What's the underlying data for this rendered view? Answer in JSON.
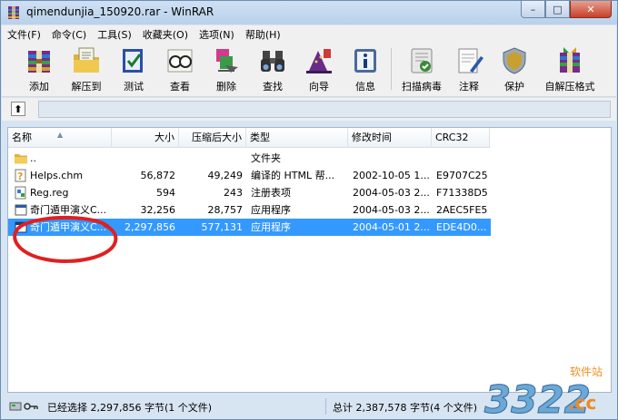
{
  "window": {
    "title": "qimendunjia_150920.rar - WinRAR",
    "controls": {
      "minimize": "–",
      "maximize": "□",
      "close": "✕"
    }
  },
  "menu": [
    "文件(F)",
    "命令(C)",
    "工具(S)",
    "收藏夹(O)",
    "选项(N)",
    "帮助(H)"
  ],
  "toolbar": {
    "add": "添加",
    "extract_to": "解压到",
    "test": "测试",
    "view": "查看",
    "delete": "删除",
    "find": "查找",
    "wizard": "向导",
    "info": "信息",
    "scan_virus": "扫描病毒",
    "comment": "注释",
    "protect": "保护",
    "sfx": "自解压格式"
  },
  "pathbar": {
    "up_icon": "up-arrow-icon"
  },
  "columns": {
    "name": "名称",
    "size": "大小",
    "packed": "压缩后大小",
    "type": "类型",
    "modified": "修改时间",
    "crc": "CRC32"
  },
  "files": [
    {
      "name": "..",
      "size": "",
      "packed": "",
      "type": "文件夹",
      "modified": "",
      "crc": "",
      "icon": "folder-icon"
    },
    {
      "name": "Helps.chm",
      "size": "56,872",
      "packed": "49,249",
      "type": "编译的 HTML 帮...",
      "modified": "2002-10-05 1...",
      "crc": "E9707C25",
      "icon": "chm-help-icon"
    },
    {
      "name": "Reg.reg",
      "size": "594",
      "packed": "243",
      "type": "注册表项",
      "modified": "2004-05-03 2...",
      "crc": "F71338D5",
      "icon": "registry-icon"
    },
    {
      "name": "奇门遁甲演义C...",
      "size": "32,256",
      "packed": "28,757",
      "type": "应用程序",
      "modified": "2004-05-03 2...",
      "crc": "2AEC5FE5",
      "icon": "exe-icon"
    },
    {
      "name": "奇门遁甲演义C...",
      "size": "2,297,856",
      "packed": "577,131",
      "type": "应用程序",
      "modified": "2004-05-01 2...",
      "crc": "EDE4D0...",
      "icon": "exe-icon"
    }
  ],
  "selected_row": 4,
  "status": {
    "left": "已经选择 2,297,856 字节(1 个文件)",
    "right": "总计 2,387,578 字节(4 个文件)"
  },
  "watermark": {
    "text": "3322",
    "suffix": ".cc",
    "tag": "软件站"
  },
  "colors": {
    "selection": "#3399ff",
    "annotation": "#e02020",
    "frame": "#d7e4f2",
    "close_button": "#c7402a"
  }
}
